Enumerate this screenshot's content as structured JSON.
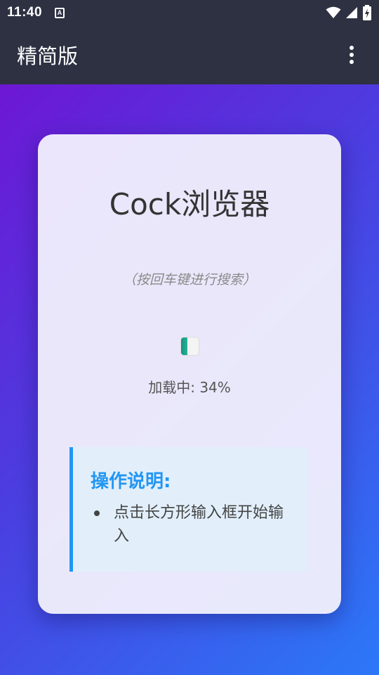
{
  "status_bar": {
    "time": "11:40",
    "notification_icon_letter": "A",
    "icons": [
      "wifi-icon",
      "signal-icon",
      "battery-charging-icon"
    ]
  },
  "app_bar": {
    "title": "精简版",
    "menu_icon": "more-vert-icon"
  },
  "card": {
    "title": "Cock浏览器",
    "hint": "（按回车键进行搜索）",
    "loading": {
      "text": "加载中: 34%",
      "progress_percent": 34
    },
    "instructions": {
      "title": "操作说明:",
      "items": [
        "点击长方形输入框开始输入"
      ]
    }
  },
  "colors": {
    "bar_background": "#2d3142",
    "gradient_start": "#6d17d4",
    "gradient_end": "#2b78f8",
    "accent_blue": "#2196f3",
    "loader_green": "#22b59b"
  }
}
